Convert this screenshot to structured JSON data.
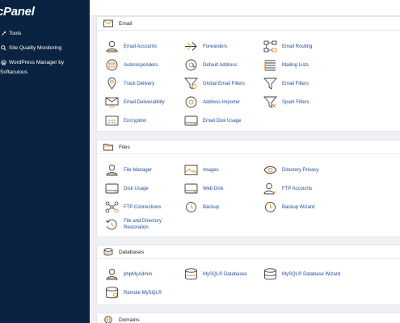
{
  "sidebar": {
    "logo": "cPanel",
    "items": [
      {
        "label": "Tools",
        "icon": "tools-icon"
      },
      {
        "label": "Site Quality Monitoring",
        "icon": "search-icon"
      },
      {
        "label": "WordPress Manager by",
        "icon": "wordpress-icon"
      }
    ],
    "wordpress_sub": "Softaculous"
  },
  "sections": {
    "email": {
      "title": "Email",
      "items": [
        {
          "label": "Email Accounts",
          "icon": "user-icon"
        },
        {
          "label": "Forwarders",
          "icon": "arrow-right-icon"
        },
        {
          "label": "Email Routing",
          "icon": "routing-icon"
        },
        {
          "label": "Autoresponders",
          "icon": "autoresponder-icon"
        },
        {
          "label": "Default Address",
          "icon": "at-sign-icon"
        },
        {
          "label": "Mailing Lists",
          "icon": "list-icon"
        },
        {
          "label": "Track Delivery",
          "icon": "map-pin-icon"
        },
        {
          "label": "Global Email Filters",
          "icon": "filter-icon"
        },
        {
          "label": "Email Filters",
          "icon": "filter-icon"
        },
        {
          "label": "Email Deliverability",
          "icon": "key-icon"
        },
        {
          "label": "Address Importer",
          "icon": "at-sign-icon"
        },
        {
          "label": "Spam Filters",
          "icon": "spam-filter-icon"
        },
        {
          "label": "Encryption",
          "icon": "encryption-icon"
        },
        {
          "label": "Email Disk Usage",
          "icon": "disk-icon"
        }
      ]
    },
    "files": {
      "title": "Files",
      "items": [
        {
          "label": "File Manager",
          "icon": "user-icon"
        },
        {
          "label": "Images",
          "icon": "image-icon"
        },
        {
          "label": "Directory Privacy",
          "icon": "eye-icon"
        },
        {
          "label": "Disk Usage",
          "icon": "disk-icon"
        },
        {
          "label": "Web Disk",
          "icon": "disk-icon"
        },
        {
          "label": "FTP Accounts",
          "icon": "user-icon"
        },
        {
          "label": "FTP Connections",
          "icon": "network-icon"
        },
        {
          "label": "Backup",
          "icon": "backup-icon"
        },
        {
          "label": "Backup Wizard",
          "icon": "backup-icon"
        },
        {
          "label": "File and Directory Restoration",
          "icon": "restore-icon"
        }
      ]
    },
    "databases": {
      "title": "Databases",
      "items": [
        {
          "label": "phpMyAdmin",
          "icon": "user-icon"
        },
        {
          "label": "MySQL® Databases",
          "icon": "database-icon"
        },
        {
          "label": "MySQL® Database Wizard",
          "icon": "database-icon"
        },
        {
          "label": "Remote MySQL®",
          "icon": "database-icon"
        }
      ]
    },
    "domains": {
      "title": "Domains"
    }
  },
  "colors": {
    "sidebar_bg": "#0a2340",
    "link": "#234a9b",
    "icon_stroke": "#3a3f47",
    "icon_accent": "#f08a24"
  }
}
